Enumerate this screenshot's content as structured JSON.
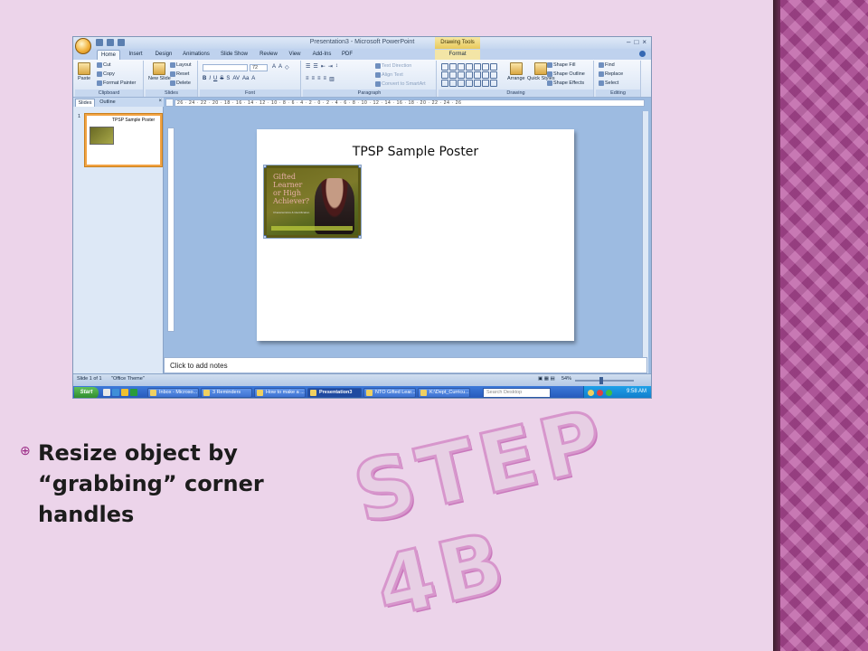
{
  "slide": {
    "bullet_text": "Resize object by “grabbing” corner handles",
    "step_label": "STEP 4B"
  },
  "window": {
    "title": "Presentation3 - Microsoft PowerPoint",
    "context_tools": "Drawing Tools",
    "controls": [
      "–",
      "□",
      "×"
    ]
  },
  "ribbon": {
    "tabs": [
      "Home",
      "Insert",
      "Design",
      "Animations",
      "Slide Show",
      "Review",
      "View",
      "Add-Ins",
      "PDF",
      "Format"
    ],
    "active_tab": "Home",
    "clipboard": {
      "paste": "Paste",
      "cut": "Cut",
      "copy": "Copy",
      "format_painter": "Format Painter",
      "label": "Clipboard"
    },
    "slides": {
      "new_slide": "New Slide",
      "layout": "Layout",
      "reset": "Reset",
      "delete": "Delete",
      "label": "Slides"
    },
    "font": {
      "size": "72",
      "label": "Font"
    },
    "paragraph": {
      "text_direction": "Text Direction",
      "align_text": "Align Text",
      "convert_smartart": "Convert to SmartArt",
      "label": "Paragraph"
    },
    "drawing": {
      "arrange": "Arrange",
      "quick_styles": "Quick Styles",
      "shape_fill": "Shape Fill",
      "shape_outline": "Shape Outline",
      "shape_effects": "Shape Effects",
      "label": "Drawing"
    },
    "editing": {
      "find": "Find",
      "replace": "Replace",
      "select": "Select",
      "label": "Editing"
    }
  },
  "panes": {
    "tab_slides": "Slides",
    "tab_outline": "Outline",
    "thumb_number": "1",
    "thumb_title": "TPSP Sample Poster"
  },
  "ruler": {
    "horizontal": "26 · 24 · 22 · 20 · 18 · 16 · 14 · 12 · 10 · 8 · 6 · 4 · 2 · 0 · 2 · 4 · 6 · 8 · 10 · 12 · 14 · 16 · 18 · 20 · 22 · 24 · 26"
  },
  "editor": {
    "slide_title": "TPSP Sample Poster",
    "poster_heading": "Gifted Learner or High Achiever?",
    "poster_sub": "Characteristics & Identification",
    "notes_placeholder": "Click to add notes"
  },
  "status": {
    "slide_of": "Slide 1 of 1",
    "theme": "\"Office Theme\"",
    "zoom": "54%"
  },
  "taskbar": {
    "start": "Start",
    "items": [
      "Inbox - Microso...",
      "3 Reminders",
      "How to make a ...",
      "Presentation3",
      "NTO Gifted Lear...",
      "K:\\Dept_Curricu..."
    ],
    "active_index": 3,
    "search_placeholder": "Search Desktop",
    "time": "9:58 AM"
  },
  "colors": {
    "background": "#ecd4ea",
    "accent_band": "#b44a9a",
    "step_fill": "#e7cfe4",
    "step_stroke": "#d796cc"
  }
}
